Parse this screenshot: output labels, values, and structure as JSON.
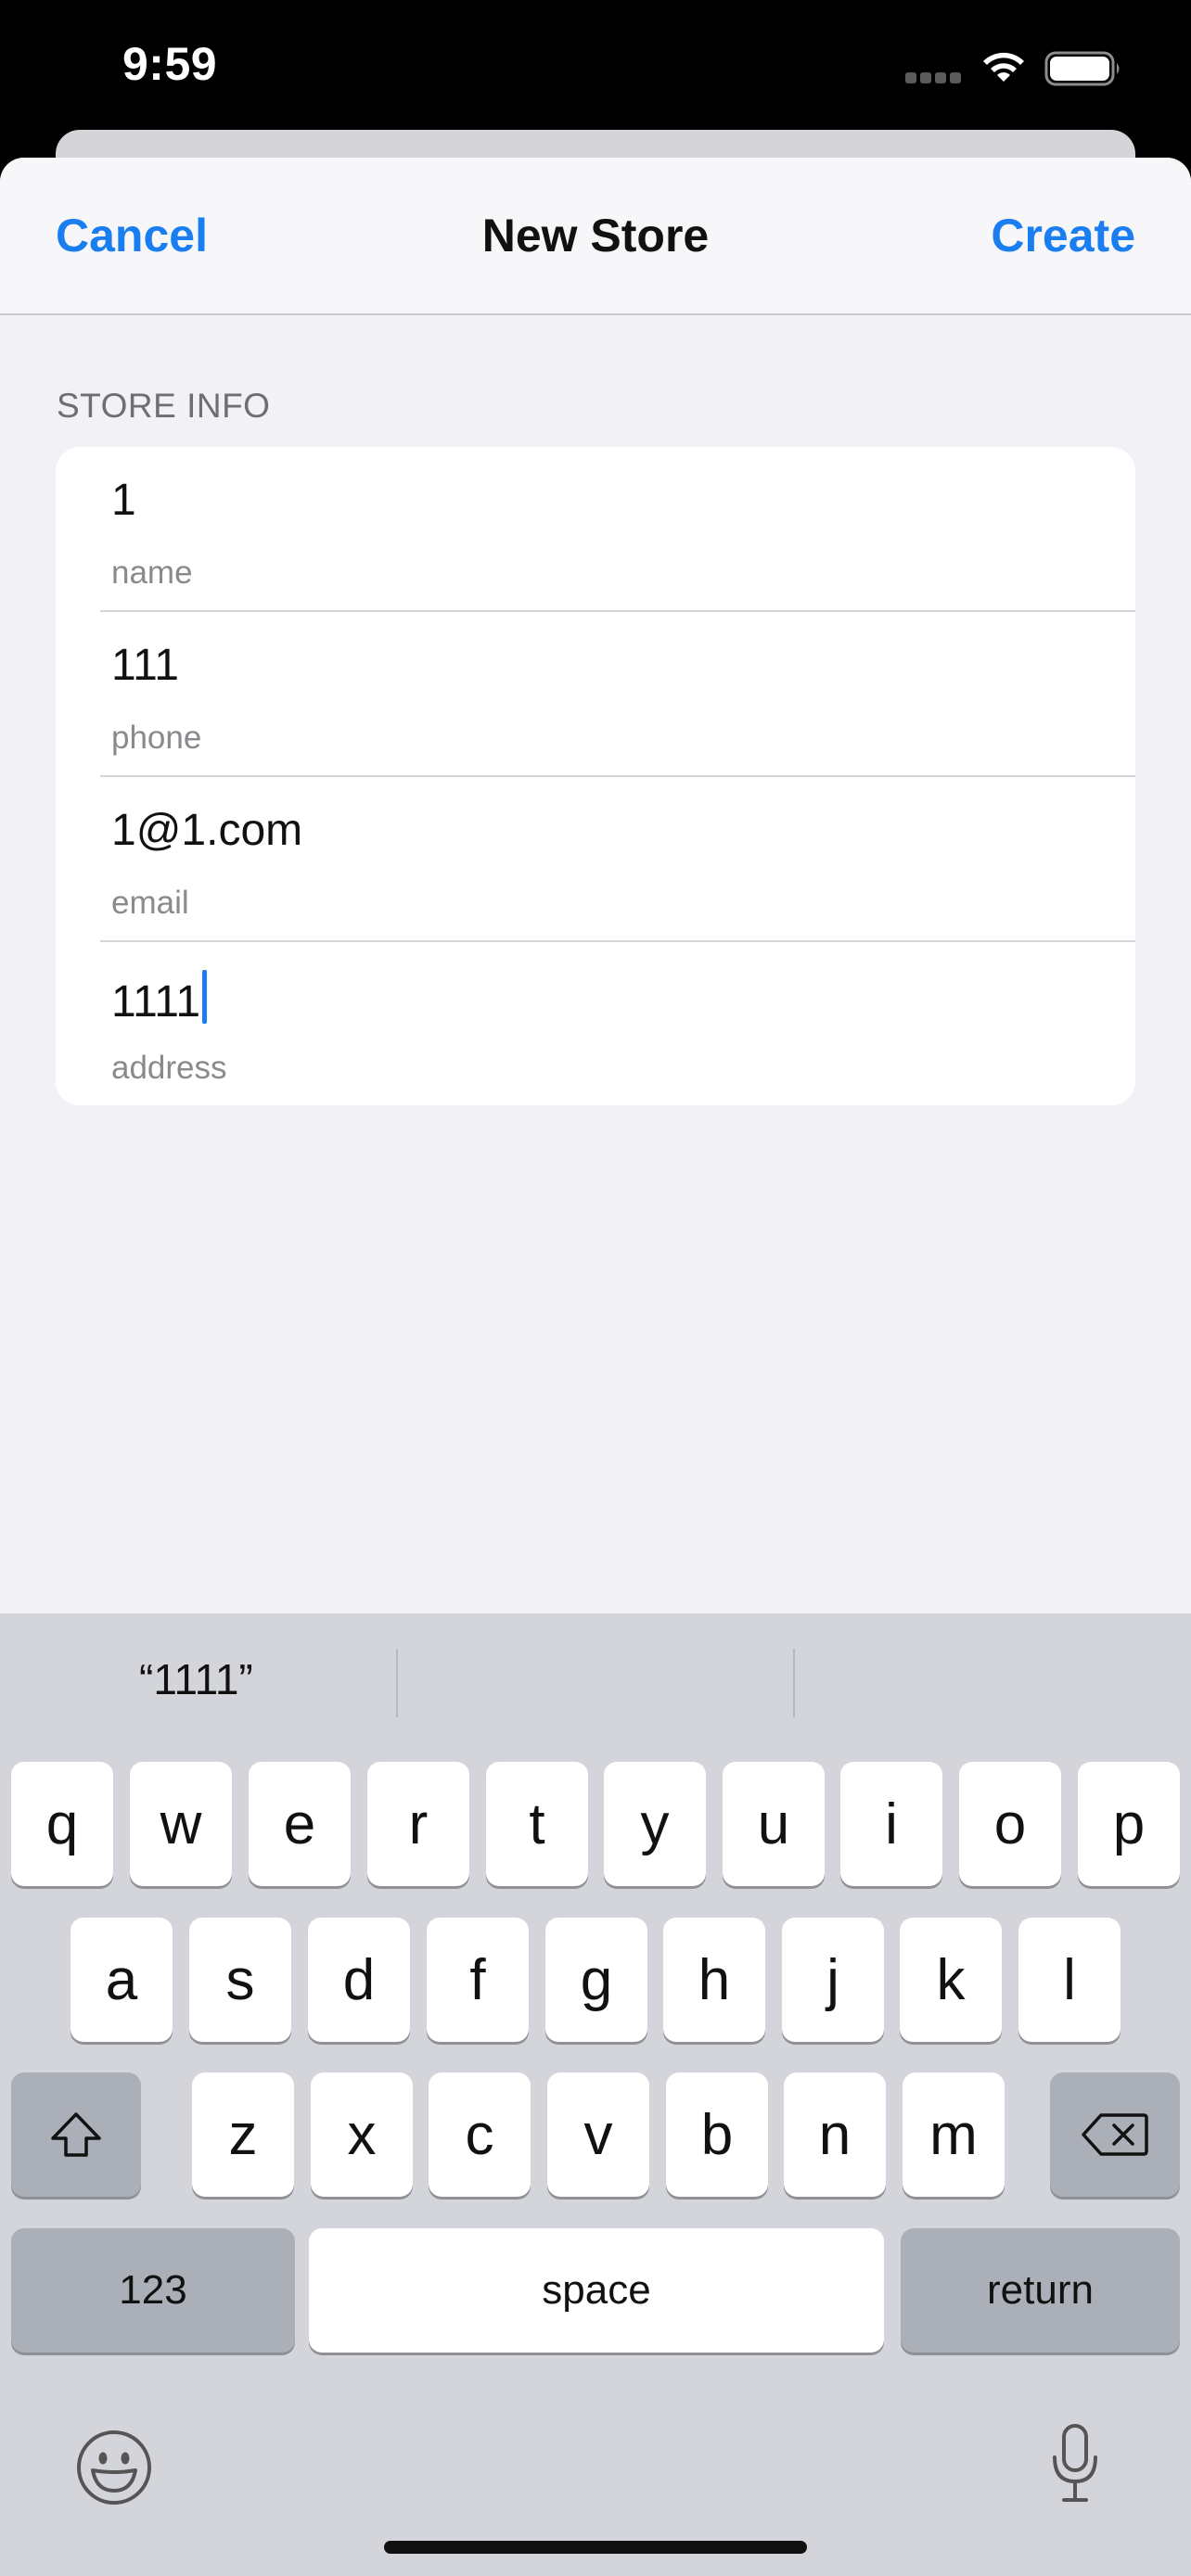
{
  "status_bar": {
    "time": "9:59"
  },
  "navbar": {
    "cancel_label": "Cancel",
    "title": "New Store",
    "create_label": "Create"
  },
  "form": {
    "section_header": "STORE INFO",
    "fields": [
      {
        "value": "1",
        "label": "name"
      },
      {
        "value": "111",
        "label": "phone"
      },
      {
        "value": "1@1.com",
        "label": "email"
      },
      {
        "value": "1111",
        "label": "address"
      }
    ]
  },
  "keyboard": {
    "suggestion": "“1111”",
    "row1": [
      "q",
      "w",
      "e",
      "r",
      "t",
      "y",
      "u",
      "i",
      "o",
      "p"
    ],
    "row2": [
      "a",
      "s",
      "d",
      "f",
      "g",
      "h",
      "j",
      "k",
      "l"
    ],
    "row3": [
      "z",
      "x",
      "c",
      "v",
      "b",
      "n",
      "m"
    ],
    "numbers_label": "123",
    "space_label": "space",
    "return_label": "return"
  },
  "colors": {
    "accent": "#1a7ef0",
    "background": "#f1f1f6",
    "keyboard": "#d3d5da"
  },
  "icons": [
    "wifi-icon",
    "battery-icon",
    "shift-icon",
    "delete-icon",
    "emoji-icon",
    "microphone-icon"
  ]
}
